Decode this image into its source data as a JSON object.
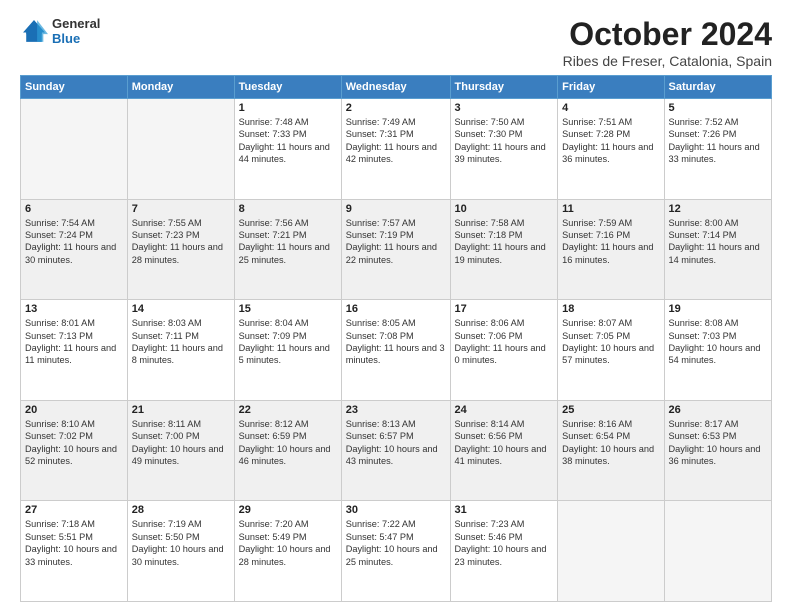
{
  "header": {
    "logo_general": "General",
    "logo_blue": "Blue",
    "month_title": "October 2024",
    "location": "Ribes de Freser, Catalonia, Spain"
  },
  "days_of_week": [
    "Sunday",
    "Monday",
    "Tuesday",
    "Wednesday",
    "Thursday",
    "Friday",
    "Saturday"
  ],
  "weeks": [
    [
      {
        "day": "",
        "info": "",
        "empty": true
      },
      {
        "day": "",
        "info": "",
        "empty": true
      },
      {
        "day": "1",
        "info": "Sunrise: 7:48 AM\nSunset: 7:33 PM\nDaylight: 11 hours and 44 minutes."
      },
      {
        "day": "2",
        "info": "Sunrise: 7:49 AM\nSunset: 7:31 PM\nDaylight: 11 hours and 42 minutes."
      },
      {
        "day": "3",
        "info": "Sunrise: 7:50 AM\nSunset: 7:30 PM\nDaylight: 11 hours and 39 minutes."
      },
      {
        "day": "4",
        "info": "Sunrise: 7:51 AM\nSunset: 7:28 PM\nDaylight: 11 hours and 36 minutes."
      },
      {
        "day": "5",
        "info": "Sunrise: 7:52 AM\nSunset: 7:26 PM\nDaylight: 11 hours and 33 minutes."
      }
    ],
    [
      {
        "day": "6",
        "info": "Sunrise: 7:54 AM\nSunset: 7:24 PM\nDaylight: 11 hours and 30 minutes."
      },
      {
        "day": "7",
        "info": "Sunrise: 7:55 AM\nSunset: 7:23 PM\nDaylight: 11 hours and 28 minutes."
      },
      {
        "day": "8",
        "info": "Sunrise: 7:56 AM\nSunset: 7:21 PM\nDaylight: 11 hours and 25 minutes."
      },
      {
        "day": "9",
        "info": "Sunrise: 7:57 AM\nSunset: 7:19 PM\nDaylight: 11 hours and 22 minutes."
      },
      {
        "day": "10",
        "info": "Sunrise: 7:58 AM\nSunset: 7:18 PM\nDaylight: 11 hours and 19 minutes."
      },
      {
        "day": "11",
        "info": "Sunrise: 7:59 AM\nSunset: 7:16 PM\nDaylight: 11 hours and 16 minutes."
      },
      {
        "day": "12",
        "info": "Sunrise: 8:00 AM\nSunset: 7:14 PM\nDaylight: 11 hours and 14 minutes."
      }
    ],
    [
      {
        "day": "13",
        "info": "Sunrise: 8:01 AM\nSunset: 7:13 PM\nDaylight: 11 hours and 11 minutes."
      },
      {
        "day": "14",
        "info": "Sunrise: 8:03 AM\nSunset: 7:11 PM\nDaylight: 11 hours and 8 minutes."
      },
      {
        "day": "15",
        "info": "Sunrise: 8:04 AM\nSunset: 7:09 PM\nDaylight: 11 hours and 5 minutes."
      },
      {
        "day": "16",
        "info": "Sunrise: 8:05 AM\nSunset: 7:08 PM\nDaylight: 11 hours and 3 minutes."
      },
      {
        "day": "17",
        "info": "Sunrise: 8:06 AM\nSunset: 7:06 PM\nDaylight: 11 hours and 0 minutes."
      },
      {
        "day": "18",
        "info": "Sunrise: 8:07 AM\nSunset: 7:05 PM\nDaylight: 10 hours and 57 minutes."
      },
      {
        "day": "19",
        "info": "Sunrise: 8:08 AM\nSunset: 7:03 PM\nDaylight: 10 hours and 54 minutes."
      }
    ],
    [
      {
        "day": "20",
        "info": "Sunrise: 8:10 AM\nSunset: 7:02 PM\nDaylight: 10 hours and 52 minutes."
      },
      {
        "day": "21",
        "info": "Sunrise: 8:11 AM\nSunset: 7:00 PM\nDaylight: 10 hours and 49 minutes."
      },
      {
        "day": "22",
        "info": "Sunrise: 8:12 AM\nSunset: 6:59 PM\nDaylight: 10 hours and 46 minutes."
      },
      {
        "day": "23",
        "info": "Sunrise: 8:13 AM\nSunset: 6:57 PM\nDaylight: 10 hours and 43 minutes."
      },
      {
        "day": "24",
        "info": "Sunrise: 8:14 AM\nSunset: 6:56 PM\nDaylight: 10 hours and 41 minutes."
      },
      {
        "day": "25",
        "info": "Sunrise: 8:16 AM\nSunset: 6:54 PM\nDaylight: 10 hours and 38 minutes."
      },
      {
        "day": "26",
        "info": "Sunrise: 8:17 AM\nSunset: 6:53 PM\nDaylight: 10 hours and 36 minutes."
      }
    ],
    [
      {
        "day": "27",
        "info": "Sunrise: 7:18 AM\nSunset: 5:51 PM\nDaylight: 10 hours and 33 minutes."
      },
      {
        "day": "28",
        "info": "Sunrise: 7:19 AM\nSunset: 5:50 PM\nDaylight: 10 hours and 30 minutes."
      },
      {
        "day": "29",
        "info": "Sunrise: 7:20 AM\nSunset: 5:49 PM\nDaylight: 10 hours and 28 minutes."
      },
      {
        "day": "30",
        "info": "Sunrise: 7:22 AM\nSunset: 5:47 PM\nDaylight: 10 hours and 25 minutes."
      },
      {
        "day": "31",
        "info": "Sunrise: 7:23 AM\nSunset: 5:46 PM\nDaylight: 10 hours and 23 minutes."
      },
      {
        "day": "",
        "info": "",
        "empty": true
      },
      {
        "day": "",
        "info": "",
        "empty": true
      }
    ]
  ]
}
